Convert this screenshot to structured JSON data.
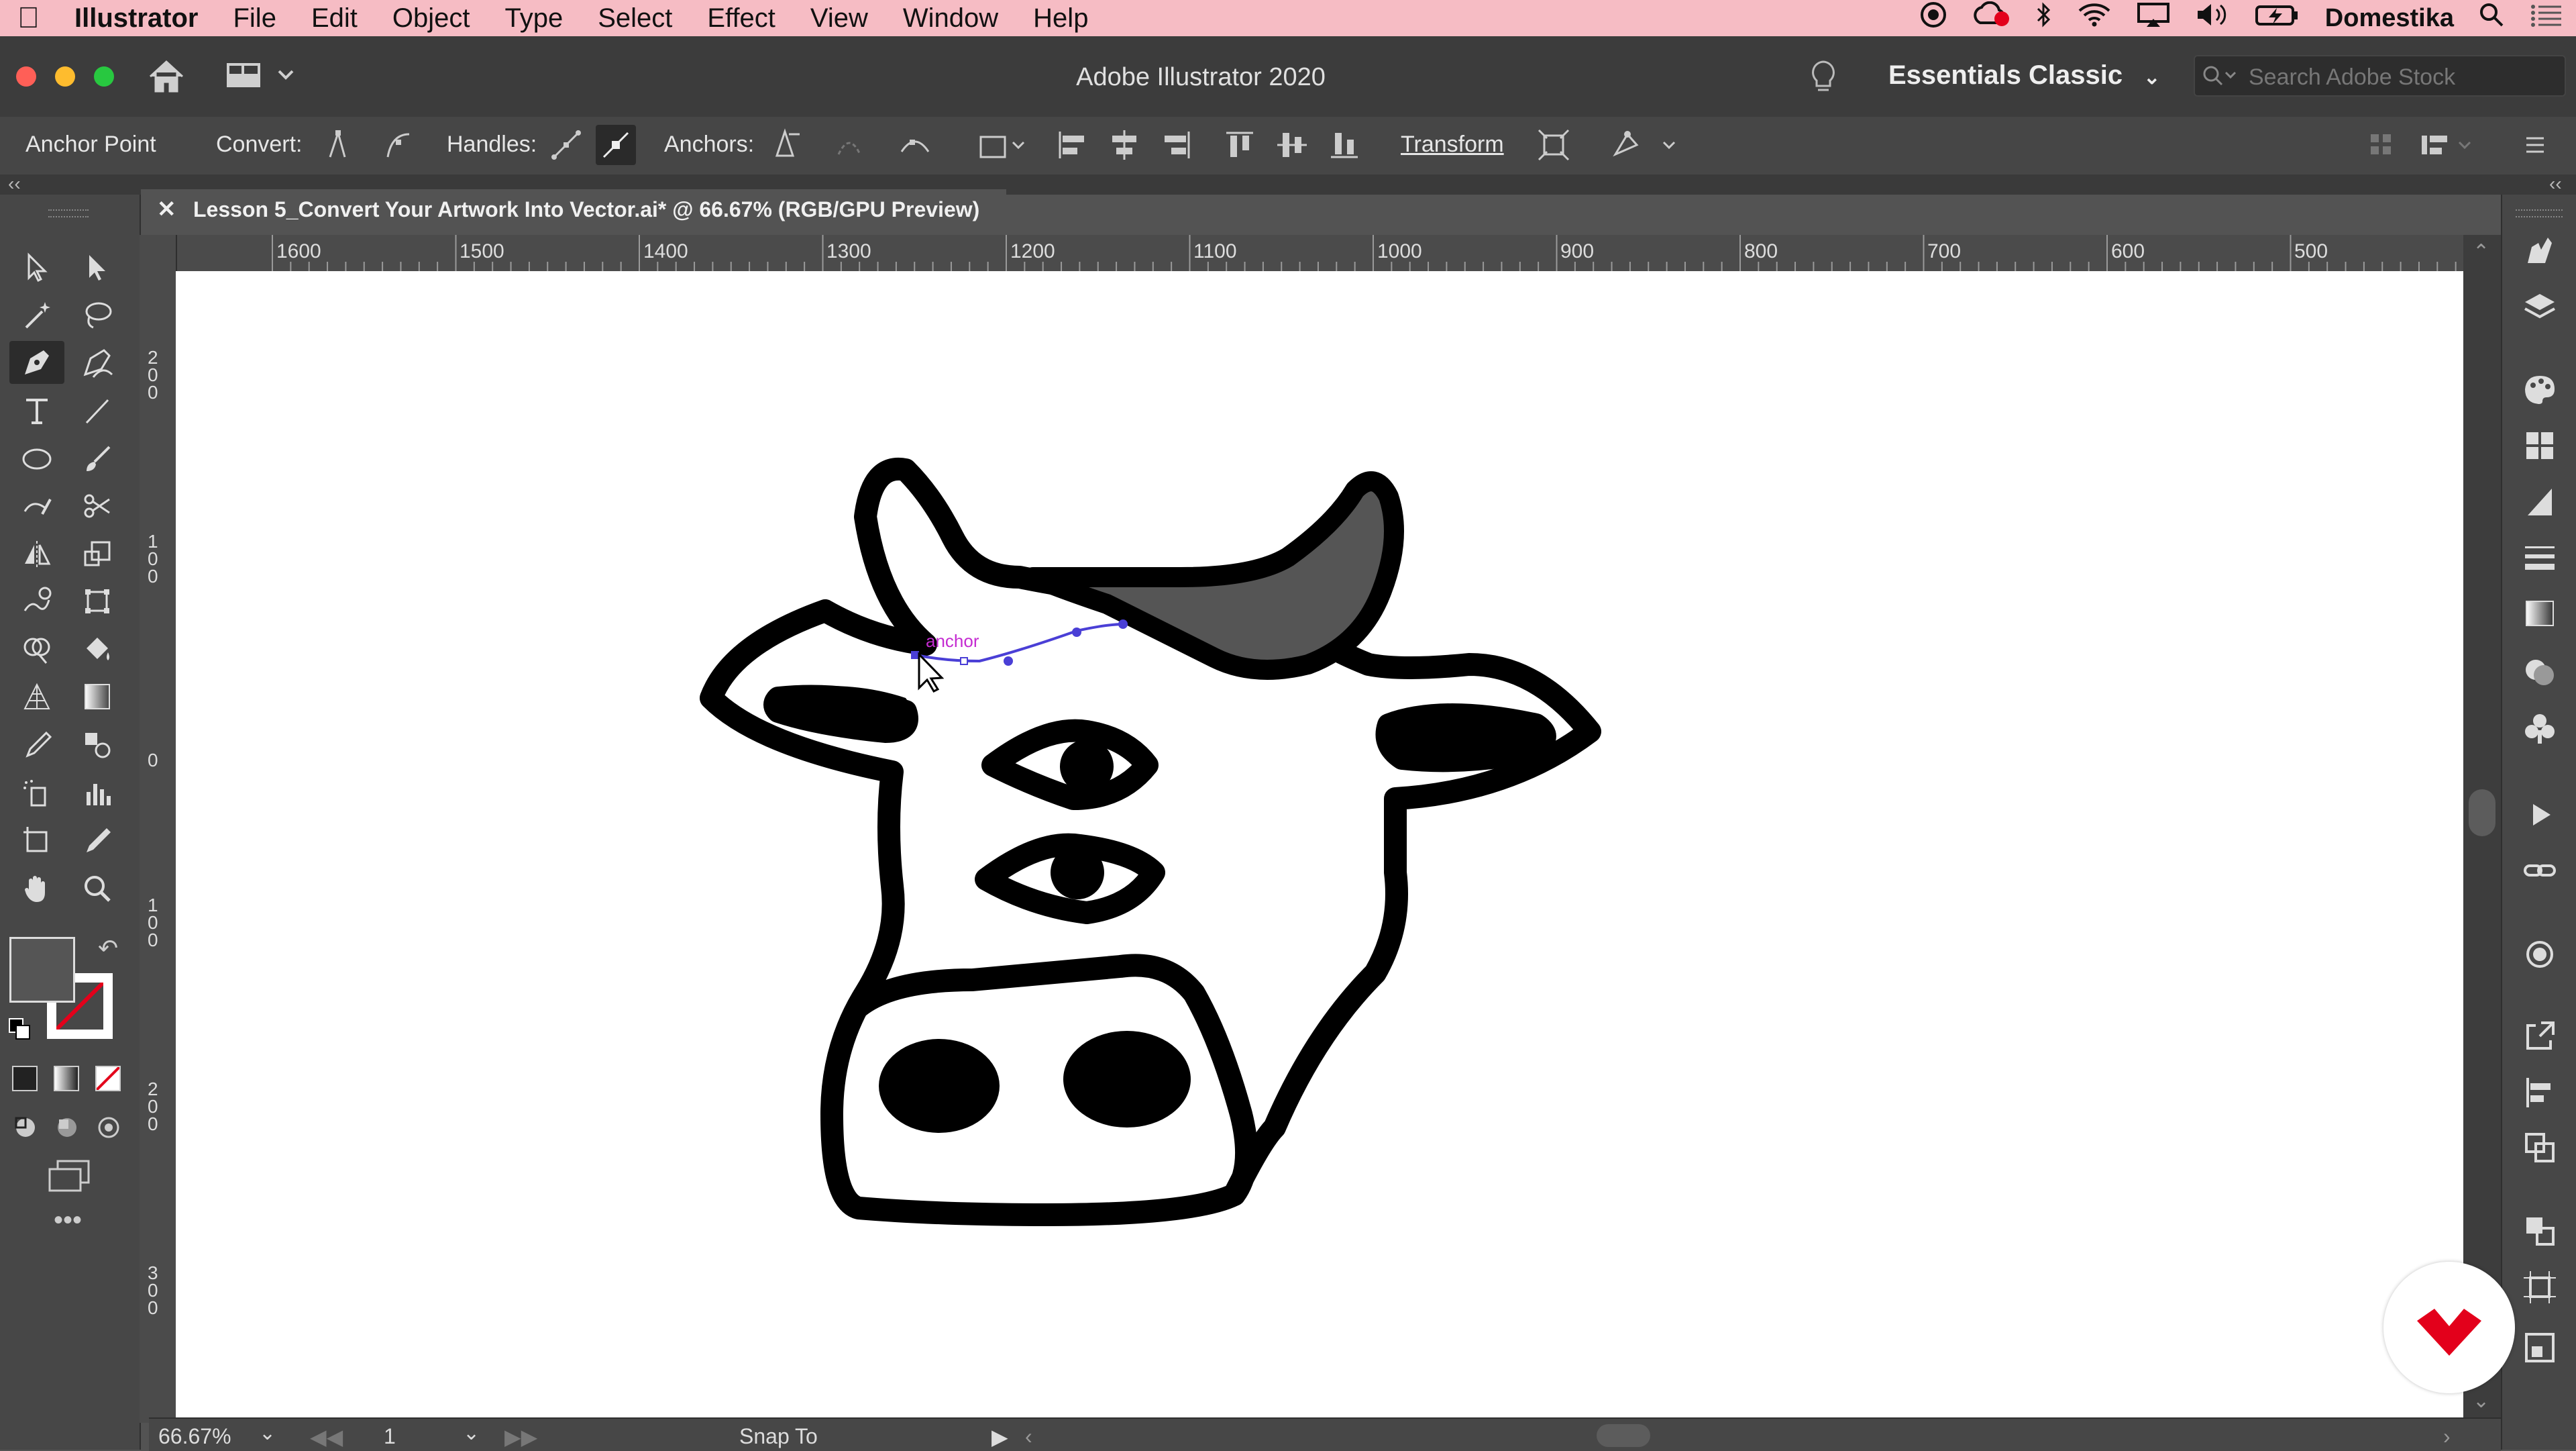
{
  "menubar": {
    "apple": "",
    "app_name": "Illustrator",
    "items": [
      "File",
      "Edit",
      "Object",
      "Type",
      "Select",
      "Effect",
      "View",
      "Window",
      "Help"
    ],
    "right_user": "Domestika"
  },
  "titlebar": {
    "title": "Adobe Illustrator 2020",
    "workspace": "Essentials Classic",
    "search_placeholder": "Search Adobe Stock"
  },
  "controlbar": {
    "tool_name": "Anchor Point",
    "convert_label": "Convert:",
    "handles_label": "Handles:",
    "anchors_label": "Anchors:",
    "transform_label": "Transform"
  },
  "document": {
    "tab_title": "Lesson 5_Convert Your Artwork Into Vector.ai* @ 66.67% (RGB/GPU Preview)"
  },
  "ruler": {
    "top_ticks": [
      "1600",
      "1500",
      "1400",
      "1300",
      "1200",
      "1100",
      "1000",
      "900",
      "800",
      "700",
      "600",
      "500"
    ],
    "left_ticks": [
      "200",
      "100",
      "0",
      "100",
      "200",
      "300"
    ]
  },
  "canvas": {
    "anchor_label": "anchor"
  },
  "statusbar": {
    "zoom": "66.67%",
    "artboard_number": "1",
    "status": "Snap To"
  },
  "colors": {
    "accent_menubar": "#f6bcc4",
    "horn_fill": "#555555",
    "path_highlight": "#4a3fd6",
    "domestika_red": "#e3001b"
  }
}
